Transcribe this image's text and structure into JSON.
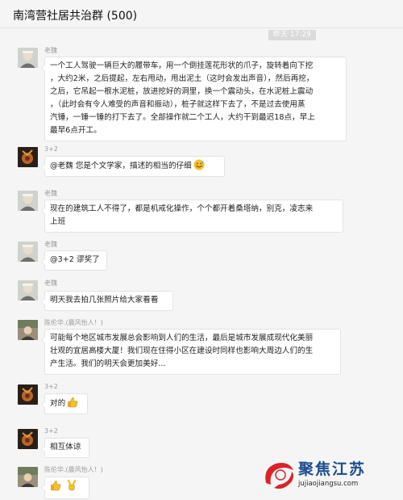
{
  "header": {
    "title": "南湾营社居共治群 (500)"
  },
  "time_divider": "昨天 17:29",
  "messages": [
    {
      "sender": "老魏",
      "avatar": "photo-avatar-laowei",
      "lines": [
        "一个工人驾驶一辆巨大的履带车，用一个倒挂莲花形状的爪子，旋转着向下挖",
        "，大约2米，之后提起，左右甩动，甩出泥土（这时会发出声音），然后再挖，",
        "之后，它吊起一根水泥桩，放进挖好的洞里，换一个震动头，在水泥桩上震动",
        "，（此时会有令人难受的声音和振动），桩子就这样下去了，不是过去使用蒸",
        "汽锤，一锤一锤的打下去了。全部操作就二个工人，大约干到最迟18点，早上",
        "最早6点开工。"
      ]
    },
    {
      "sender": "3+2",
      "avatar": "photo-avatar-dark",
      "lines": [
        "@老魏 您是个文学家，描述的相当的仔细"
      ],
      "emoji": "sweat-smile-emoji"
    },
    {
      "sender": "老魏",
      "avatar": "photo-avatar-laowei",
      "lines": [
        "现在的建筑工人不得了，都是机戒化操作，个个都开着桑塔纳，别克，凌志来",
        "上班"
      ]
    },
    {
      "sender": "老魏",
      "avatar": "photo-avatar-laowei",
      "lines": [
        "@3+2 谬奖了"
      ]
    },
    {
      "sender": "老魏",
      "avatar": "photo-avatar-laowei",
      "lines": [
        "明天我去拍几张照片给大家看看"
      ]
    },
    {
      "sender": "陈伦华.(晨风怡人！)",
      "avatar": "photo-avatar-chen",
      "lines": [
        "可能每个地区城市发展总会影响到人们的生活，最后是城市发展成现代化美丽",
        "壮观的宜居高楼大厦！我们现在住得小区在建设时同样也影响大周边人们的生",
        "产生活。我们的明天会更加美好..."
      ]
    },
    {
      "sender": "3+2",
      "avatar": "photo-avatar-dark",
      "lines": [
        "对的"
      ],
      "emoji": "thumbs-up-emoji"
    },
    {
      "sender": "3+2",
      "avatar": "photo-avatar-dark",
      "lines": [
        "相互体谅"
      ]
    },
    {
      "sender": "陈伦华.(晨风怡人！)",
      "avatar": "photo-avatar-chen",
      "lines": [
        ""
      ],
      "emojis": [
        "thumbs-up-emoji",
        "victory-hand-emoji"
      ]
    }
  ],
  "watermark": {
    "logo": "jujiao-jiangsu-logo",
    "brand": "聚焦江苏",
    "url": "jujiaojiangsu.com"
  },
  "colors": {
    "background": "#f5f5f5",
    "bubble": "#ffffff",
    "bubble_border": "#e3e3e3",
    "name_text": "#9a9a9a",
    "time_pill": "#dadada",
    "brand_blue": "#1d4d8e",
    "brand_red": "#d8232a"
  }
}
